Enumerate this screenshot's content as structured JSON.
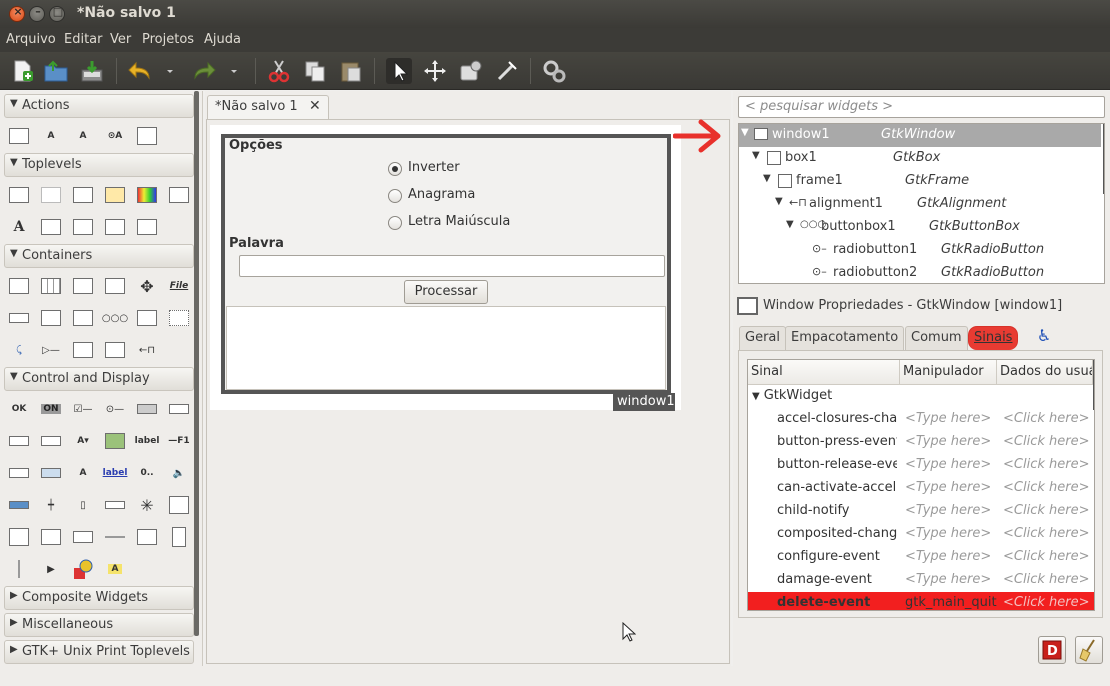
{
  "window": {
    "title": "*Não salvo 1"
  },
  "menu": [
    "Arquivo",
    "Editar",
    "Ver",
    "Projetos",
    "Ajuda"
  ],
  "palette": {
    "sections": {
      "actions": "Actions",
      "toplevels": "Toplevels",
      "containers": "Containers",
      "control": "Control and Display",
      "composite": "Composite Widgets",
      "misc": "Miscellaneous",
      "print": "GTK+ Unix Print Toplevels"
    },
    "icon_labels": {
      "file": "File",
      "ok": "OK",
      "on": "ON",
      "label": "label",
      "f1": "F1",
      "a": "A",
      "zero": "0..",
      "label_blue": "label"
    }
  },
  "document": {
    "tab_label": "*Não salvo 1",
    "close_glyph": "✕",
    "frame_label": "Opções",
    "radios": [
      "Inverter",
      "Anagrama",
      "Letra Maiúscula"
    ],
    "entry_label": "Palavra",
    "button_label": "Processar",
    "window_tag": "window1"
  },
  "inspector": {
    "search_placeholder": "< pesquisar widgets >",
    "tree": [
      {
        "name": "window1",
        "type": "GtkWindow"
      },
      {
        "name": "box1",
        "type": "GtkBox"
      },
      {
        "name": "frame1",
        "type": "GtkFrame"
      },
      {
        "name": "alignment1",
        "type": "GtkAlignment"
      },
      {
        "name": "buttonbox1",
        "type": "GtkButtonBox"
      },
      {
        "name": "radiobutton1",
        "type": "GtkRadioButton"
      },
      {
        "name": "radiobutton2",
        "type": "GtkRadioButton"
      }
    ]
  },
  "properties": {
    "header": "Window Propriedades - GtkWindow [window1]",
    "tabs": [
      "Geral",
      "Empacotamento",
      "Comum",
      "Sinais"
    ],
    "active_tab": "Sinais",
    "columns": [
      "Sinal",
      "Manipulador",
      "Dados do usuário"
    ],
    "group": "GtkWidget",
    "signals": [
      {
        "name": "accel-closures-changed",
        "handler": "<Type here>",
        "data": "<Click here>"
      },
      {
        "name": "button-press-event",
        "handler": "<Type here>",
        "data": "<Click here>"
      },
      {
        "name": "button-release-event",
        "handler": "<Type here>",
        "data": "<Click here>"
      },
      {
        "name": "can-activate-accel",
        "handler": "<Type here>",
        "data": "<Click here>"
      },
      {
        "name": "child-notify",
        "handler": "<Type here>",
        "data": "<Click here>"
      },
      {
        "name": "composited-changed",
        "handler": "<Type here>",
        "data": "<Click here>"
      },
      {
        "name": "configure-event",
        "handler": "<Type here>",
        "data": "<Click here>"
      },
      {
        "name": "damage-event",
        "handler": "<Type here>",
        "data": "<Click here>"
      },
      {
        "name": "delete-event",
        "handler": "gtk_main_quit",
        "data": "<Click here>"
      }
    ]
  },
  "colors": {
    "highlight": "#f21f1f",
    "selection": "#a9a9a9",
    "accent_arrow": "#e8302b"
  }
}
